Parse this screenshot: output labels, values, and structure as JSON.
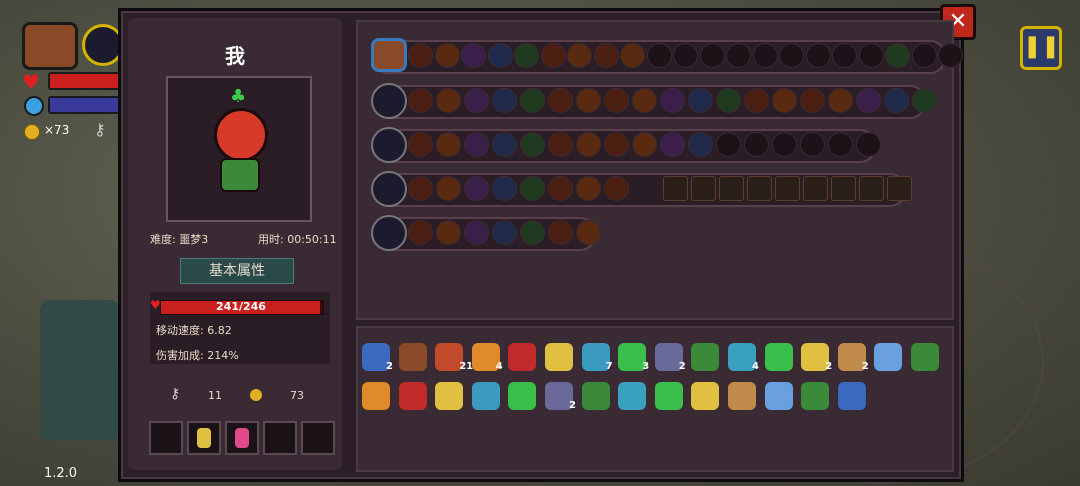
{
  "hud": {
    "coins": "×73",
    "version": "1.2.0"
  },
  "character": {
    "name": "我",
    "difficulty_label": "难度: 噩梦3",
    "time_label": "用时: 00:50:11",
    "section_title": "基本属性",
    "hp_text": "241/246",
    "hp_fraction": 0.98,
    "move_speed": "移动速度: 6.82",
    "damage_bonus": "伤害加成: 214%",
    "keys": "11",
    "coins": "73"
  },
  "weapon_rows": [
    {
      "icon": "chest-icon",
      "chips": 21
    },
    {
      "icon": "green-staff-icon",
      "chips": 19
    },
    {
      "icon": "crystal-staff-icon",
      "chips": 17
    },
    {
      "icon": "gold-staff-icon",
      "chips": 8,
      "extra": 9
    },
    {
      "icon": "purple-orb-icon",
      "chips": 7
    }
  ],
  "items": {
    "row1": [
      {
        "icon": "blue-jelly-icon",
        "count": "2"
      },
      {
        "icon": "wood-log-icon",
        "count": ""
      },
      {
        "icon": "arrow-icon",
        "count": "21"
      },
      {
        "icon": "arrow-plus-icon",
        "count": "4"
      },
      {
        "icon": "demon-face-icon",
        "count": ""
      },
      {
        "icon": "potion-icon",
        "count": ""
      },
      {
        "icon": "blue-arrow-icon",
        "count": "7"
      },
      {
        "icon": "green-arrow-icon",
        "count": "3"
      },
      {
        "icon": "stone-icon",
        "count": "2"
      },
      {
        "icon": "boot-icon",
        "count": ""
      },
      {
        "icon": "crossbow-icon",
        "count": "4"
      },
      {
        "icon": "clover-icon",
        "count": ""
      },
      {
        "icon": "hook-icon",
        "count": "2"
      },
      {
        "icon": "gem-icon",
        "count": "2"
      },
      {
        "icon": "blue-wings-icon",
        "count": ""
      },
      {
        "icon": "ring-icon",
        "count": ""
      }
    ],
    "row2": [
      {
        "icon": "blue-gem-icon",
        "count": ""
      },
      {
        "icon": "spring-icon",
        "count": ""
      },
      {
        "icon": "bow-icon",
        "count": ""
      },
      {
        "icon": "cloak-icon",
        "count": ""
      },
      {
        "icon": "green-hand-icon",
        "count": ""
      },
      {
        "icon": "teeth-icon",
        "count": "2"
      },
      {
        "icon": "blue-key-icon",
        "count": ""
      },
      {
        "icon": "bat-icon",
        "count": ""
      },
      {
        "icon": "pickaxe-icon",
        "count": ""
      },
      {
        "icon": "magnifier-icon",
        "count": ""
      },
      {
        "icon": "old-key-icon",
        "count": ""
      },
      {
        "icon": "bread-icon",
        "count": ""
      },
      {
        "icon": "feather-icon",
        "count": ""
      },
      {
        "icon": "green-pot-icon",
        "count": ""
      }
    ]
  },
  "colors": {
    "hp": "#c9201e",
    "mp": "#3a3a9a",
    "panel": "#2c1f28"
  }
}
